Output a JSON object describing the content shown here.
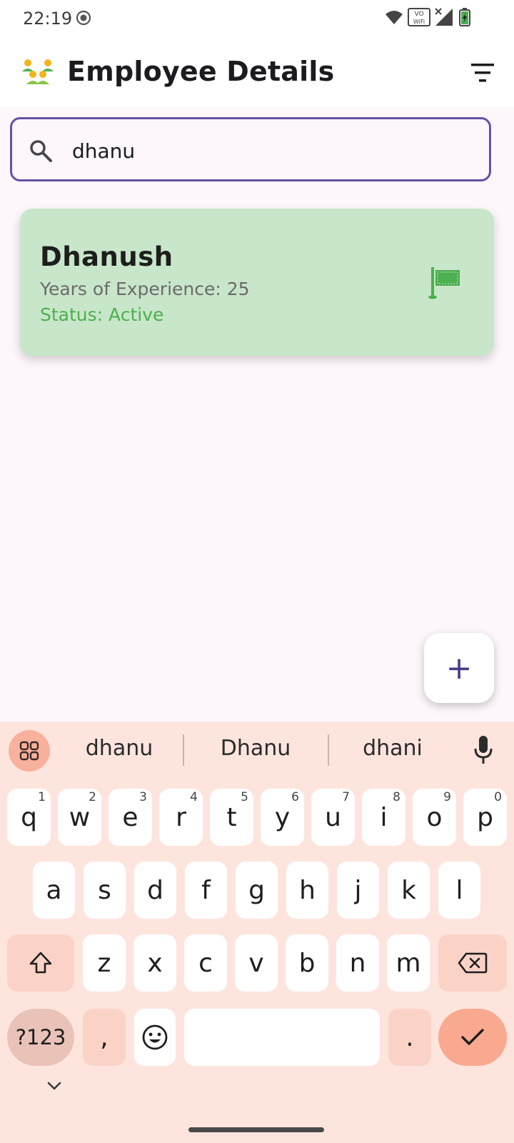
{
  "status_bar": {
    "time": "22:19"
  },
  "app_bar": {
    "title": "Employee Details",
    "logo_icon": "people-group-icon",
    "filter_icon": "filter-icon"
  },
  "search": {
    "value": "dhanu",
    "placeholder": ""
  },
  "employees": [
    {
      "name": "Dhanush",
      "experience": "Years of Experience: 25",
      "status": "Status: Active",
      "flag_color": "#4caf50"
    }
  ],
  "fab": {
    "label": "+"
  },
  "keyboard": {
    "suggestions": [
      "dhanu",
      "Dhanu",
      "dhani"
    ],
    "row1": [
      {
        "k": "q",
        "h": "1"
      },
      {
        "k": "w",
        "h": "2"
      },
      {
        "k": "e",
        "h": "3"
      },
      {
        "k": "r",
        "h": "4"
      },
      {
        "k": "t",
        "h": "5"
      },
      {
        "k": "y",
        "h": "6"
      },
      {
        "k": "u",
        "h": "7"
      },
      {
        "k": "i",
        "h": "8"
      },
      {
        "k": "o",
        "h": "9"
      },
      {
        "k": "p",
        "h": "0"
      }
    ],
    "row2": [
      "a",
      "s",
      "d",
      "f",
      "g",
      "h",
      "j",
      "k",
      "l"
    ],
    "row3": [
      "z",
      "x",
      "c",
      "v",
      "b",
      "n",
      "m"
    ],
    "symbols_label": "?123",
    "comma": ",",
    "period": "."
  },
  "colors": {
    "accent": "#6750a4",
    "card_bg": "#c8e6c9",
    "status_green": "#4caf50",
    "keyboard_bg": "#fde5de"
  }
}
